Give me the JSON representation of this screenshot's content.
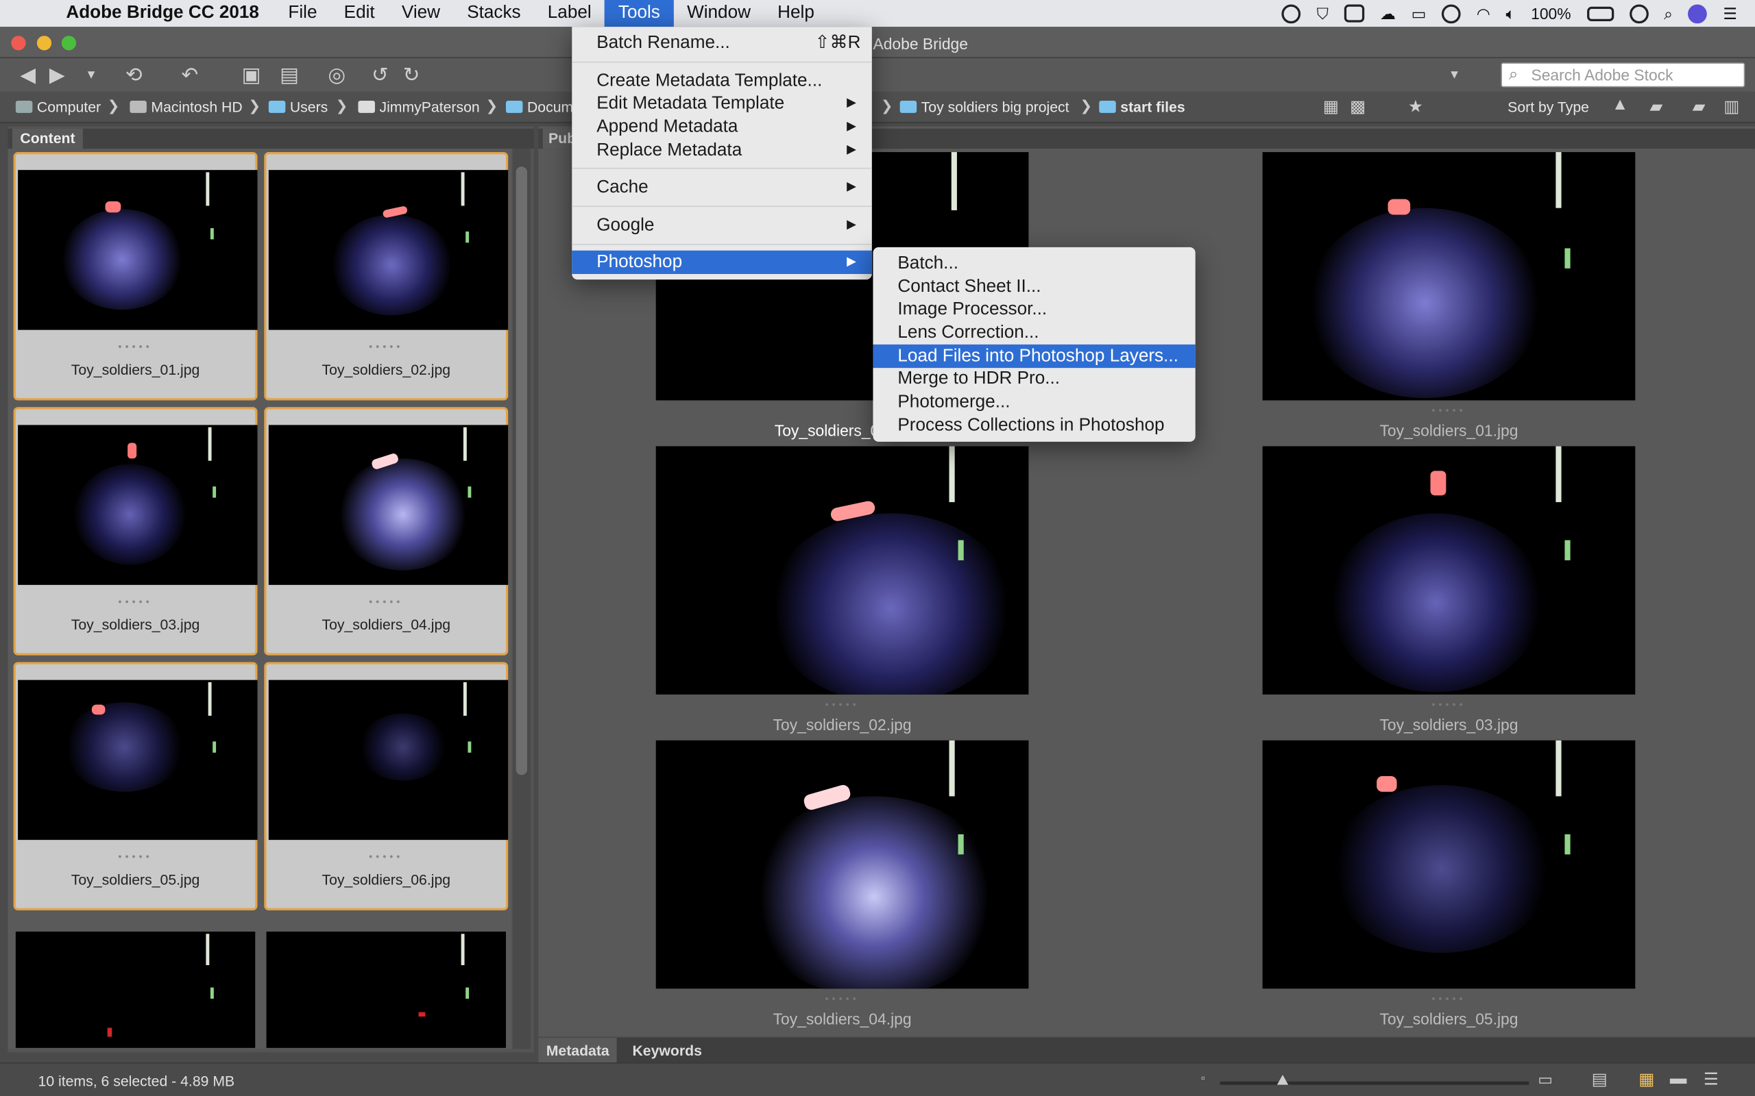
{
  "menubar": {
    "app_name": "Adobe Bridge CC 2018",
    "items": [
      "File",
      "Edit",
      "View",
      "Stacks",
      "Label",
      "Tools",
      "Window",
      "Help"
    ],
    "active_item": "Tools",
    "battery": "100%"
  },
  "window": {
    "title": "Adobe Bridge"
  },
  "search": {
    "placeholder": "Search Adobe Stock"
  },
  "path": {
    "items": [
      "Computer",
      "Macintosh HD",
      "Users",
      "JimmyPaterson",
      "Docum",
      "Toy soldiers big project",
      "start files"
    ]
  },
  "sort": {
    "label": "Sort by Type"
  },
  "left_panel": {
    "tab": "Content",
    "thumbnails": [
      {
        "name": "Toy_soldiers_01.jpg"
      },
      {
        "name": "Toy_soldiers_02.jpg"
      },
      {
        "name": "Toy_soldiers_03.jpg"
      },
      {
        "name": "Toy_soldiers_04.jpg"
      },
      {
        "name": "Toy_soldiers_05.jpg"
      },
      {
        "name": "Toy_soldiers_06.jpg"
      }
    ]
  },
  "right_panel": {
    "tab": "Pub",
    "items": [
      {
        "name": "Toy_soldiers_0"
      },
      {
        "name": "Toy_soldiers_01.jpg"
      },
      {
        "name": "Toy_soldiers_02.jpg"
      },
      {
        "name": "Toy_soldiers_03.jpg"
      },
      {
        "name": "Toy_soldiers_04.jpg"
      },
      {
        "name": "Toy_soldiers_05.jpg"
      }
    ]
  },
  "tools_menu": {
    "batch_rename": "Batch Rename...",
    "batch_rename_shortcut": "⇧⌘R",
    "create_metadata_template": "Create Metadata Template...",
    "edit_metadata_template": "Edit Metadata Template",
    "append_metadata": "Append Metadata",
    "replace_metadata": "Replace Metadata",
    "cache": "Cache",
    "google": "Google",
    "photoshop": "Photoshop"
  },
  "photoshop_submenu": {
    "items": [
      "Batch...",
      "Contact Sheet II...",
      "Image Processor...",
      "Lens Correction...",
      "Load Files into Photoshop Layers...",
      "Merge to HDR Pro...",
      "Photomerge...",
      "Process Collections in Photoshop"
    ],
    "highlighted_index": 4
  },
  "bottom_tabs": [
    "Metadata",
    "Keywords"
  ],
  "status": {
    "text": "10 items, 6 selected - 4.89 MB"
  },
  "colors": {
    "selection_blue": "#2e6ed4",
    "thumb_border": "#e2a44a"
  }
}
